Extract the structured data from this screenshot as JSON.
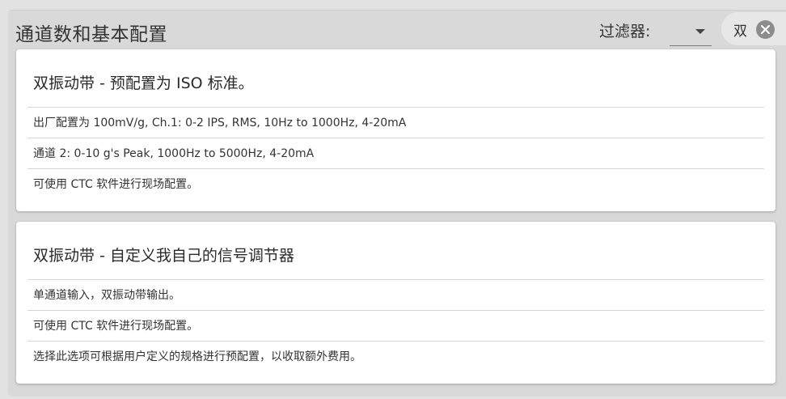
{
  "header": {
    "title": "通道数和基本配置",
    "filter_label": "过滤器:",
    "filter_value": "",
    "chip_label": "双",
    "chip_close_icon": "close-circle-icon"
  },
  "cards": [
    {
      "title": "双振动带 - 预配置为 ISO 标准。",
      "items": [
        "出厂配置为 100mV/g, Ch.1: 0-2 IPS, RMS, 10Hz to 1000Hz, 4-20mA",
        "通道 2: 0-10 g's Peak, 1000Hz to 5000Hz, 4-20mA",
        "可使用 CTC 软件进行现场配置。"
      ]
    },
    {
      "title": "双振动带 - 自定义我自己的信号调节器",
      "items": [
        "单通道输入，双振动带输出。",
        "可使用 CTC 软件进行现场配置。",
        "选择此选项可根据用户定义的规格进行预配置，以收取额外费用。"
      ]
    }
  ]
}
